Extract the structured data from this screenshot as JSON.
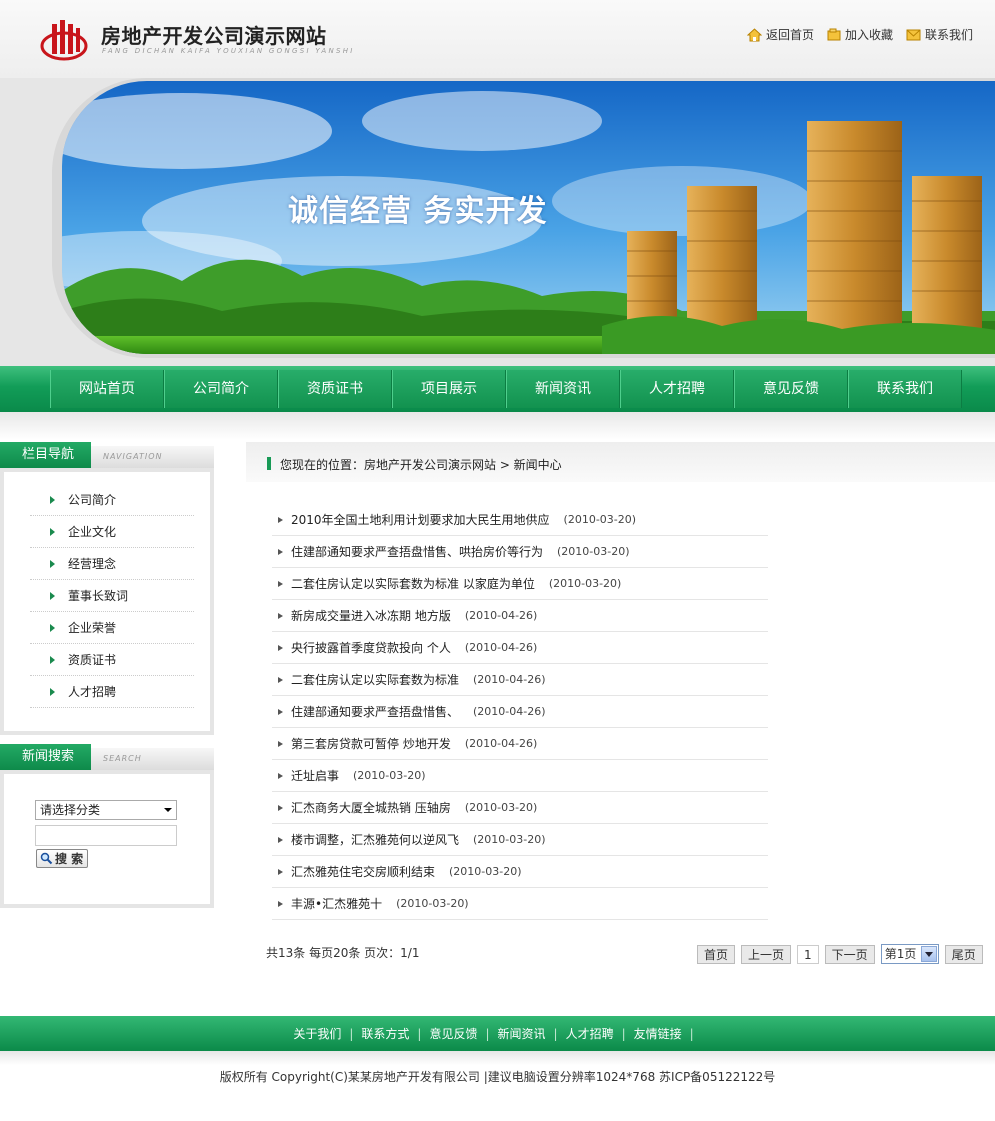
{
  "header": {
    "site_title": "房地产开发公司演示网站",
    "site_pinyin": "FANG DICHAN KAIFA YOUXIAN GONGSI YANSHI",
    "links": [
      {
        "label": "返回首页",
        "icon": "home-icon"
      },
      {
        "label": "加入收藏",
        "icon": "bookmark-icon"
      },
      {
        "label": "联系我们",
        "icon": "mail-icon"
      }
    ]
  },
  "banner": {
    "slogan": "诚信经营  务实开发"
  },
  "nav": {
    "items": [
      "网站首页",
      "公司简介",
      "资质证书",
      "项目展示",
      "新闻资讯",
      "人才招聘",
      "意见反馈",
      "联系我们"
    ]
  },
  "sidebar": {
    "nav_title": "栏目导航",
    "nav_subtitle": "NAVIGATION",
    "nav_items": [
      "公司简介",
      "企业文化",
      "经营理念",
      "董事长致词",
      "企业荣誉",
      "资质证书",
      "人才招聘"
    ],
    "search_title": "新闻搜索",
    "search_subtitle": "SEARCH",
    "search_select": "请选择分类",
    "search_button": "搜 索"
  },
  "breadcrumb": {
    "text": "您现在的位置：房地产开发公司演示网站  > 新闻中心"
  },
  "news": [
    {
      "title": "2010年全国土地利用计划要求加大民生用地供应",
      "date": "(2010-03-20)"
    },
    {
      "title": "住建部通知要求严查捂盘惜售、哄抬房价等行为",
      "date": "(2010-03-20)"
    },
    {
      "title": "二套住房认定以实际套数为标准 以家庭为单位",
      "date": "(2010-03-20)"
    },
    {
      "title": "新房成交量进入冰冻期 地方版",
      "date": "(2010-04-26)"
    },
    {
      "title": "央行披露首季度贷款投向 个人",
      "date": "(2010-04-26)"
    },
    {
      "title": "二套住房认定以实际套数为标准",
      "date": "(2010-04-26)"
    },
    {
      "title": "住建部通知要求严查捂盘惜售、",
      "date": "(2010-04-26)"
    },
    {
      "title": "第三套房贷款可暂停 炒地开发",
      "date": "(2010-04-26)"
    },
    {
      "title": "迁址启事",
      "date": "(2010-03-20)"
    },
    {
      "title": "汇杰商务大厦全城热销 压轴房",
      "date": "(2010-03-20)"
    },
    {
      "title": "楼市调整，汇杰雅苑何以逆风飞",
      "date": "(2010-03-20)"
    },
    {
      "title": "汇杰雅苑住宅交房顺利结束",
      "date": "(2010-03-20)"
    },
    {
      "title": "丰源•汇杰雅苑十",
      "date": "(2010-03-20)"
    }
  ],
  "pager": {
    "info": "共13条  每页20条  页次：1/1",
    "first": "首页",
    "prev": "上一页",
    "current": "1",
    "next": "下一页",
    "select": "第1页",
    "last": "尾页"
  },
  "footer": {
    "links": [
      "关于我们",
      "联系方式",
      "意见反馈",
      "新闻资讯",
      "人才招聘",
      "友情链接"
    ],
    "copyright": "版权所有  Copyright(C)某某房地产开发有限公司  |建议电脑设置分辨率1024*768 苏ICP备05122122号"
  },
  "colors": {
    "brand_green": "#129d58",
    "logo_red": "#c8151b"
  }
}
